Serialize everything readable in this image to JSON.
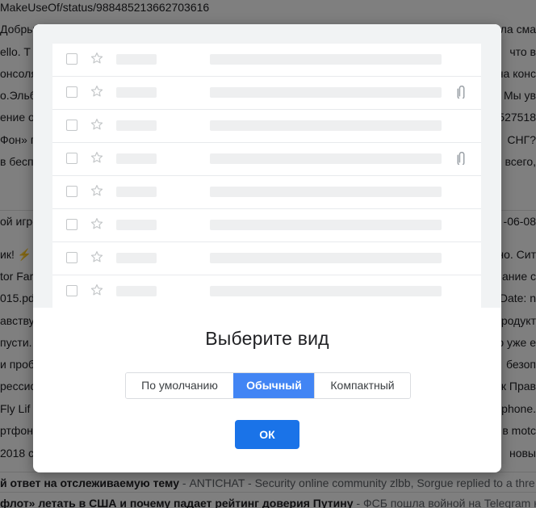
{
  "background": {
    "top_url": "MakeUseOf/status/988485213662703616",
    "rows": [
      {
        "left": "Добрый",
        "right": "ла сма"
      },
      {
        "left": "ello. T",
        "right": "что в"
      },
      {
        "left": "онсоля",
        "right": "на конс"
      },
      {
        "left": "о.Эльб",
        "right": "Мы ув"
      },
      {
        "left": "ение о",
        "right": "527518"
      },
      {
        "left": "Фон» п",
        "right": "СНГ?"
      },
      {
        "left": "в бесп",
        "right": "всего,"
      },
      {
        "left": "ой игро",
        "right": "-06-08"
      },
      {
        "left": "ик! ⚡",
        "right": "но. Сит"
      },
      {
        "left": "tor Far",
        "right": "ание с"
      },
      {
        "left": "015.pd",
        "right": "Date: n"
      },
      {
        "left": "авству",
        "right": "родукт"
      },
      {
        "left": "пусти.",
        "right": "о уже е"
      },
      {
        "left": "и проб",
        "right": "безоп"
      },
      {
        "left": "рессис",
        "right": "к Прав"
      },
      {
        "left": "Fly Lif",
        "right": "phone."
      },
      {
        "left": "ртфон",
        "right": "в motc"
      },
      {
        "left": "2018 с",
        "right": "новы"
      }
    ],
    "bottom_rows": [
      {
        "bold": "й ответ на отслеживаемую тему",
        "grey": " - ANTICHAT - Security online community zlbb, Sorgue replied to a thre"
      },
      {
        "bold": "флот» летать в США и почему падает рейтинг доверия Путину",
        "grey": " - ФСБ пошла войной на Telegram не"
      }
    ]
  },
  "dialog": {
    "title": "Выберите вид",
    "options": [
      {
        "label": "По умолчанию",
        "selected": false
      },
      {
        "label": "Обычный",
        "selected": true
      },
      {
        "label": "Компактный",
        "selected": false
      }
    ],
    "ok_label": "ОК",
    "preview_rows": [
      {
        "attachment": false
      },
      {
        "attachment": true
      },
      {
        "attachment": false
      },
      {
        "attachment": true
      },
      {
        "attachment": false
      },
      {
        "attachment": false
      },
      {
        "attachment": false
      },
      {
        "attachment": false
      }
    ]
  },
  "colors": {
    "accent": "#4285f4",
    "ok_button": "#1a73e8",
    "preview_bg": "#f1f3f4",
    "placeholder_bar": "#eeeff0"
  },
  "icons": {
    "checkbox": "checkbox-icon",
    "star": "star-icon",
    "attachment": "paperclip-icon"
  }
}
